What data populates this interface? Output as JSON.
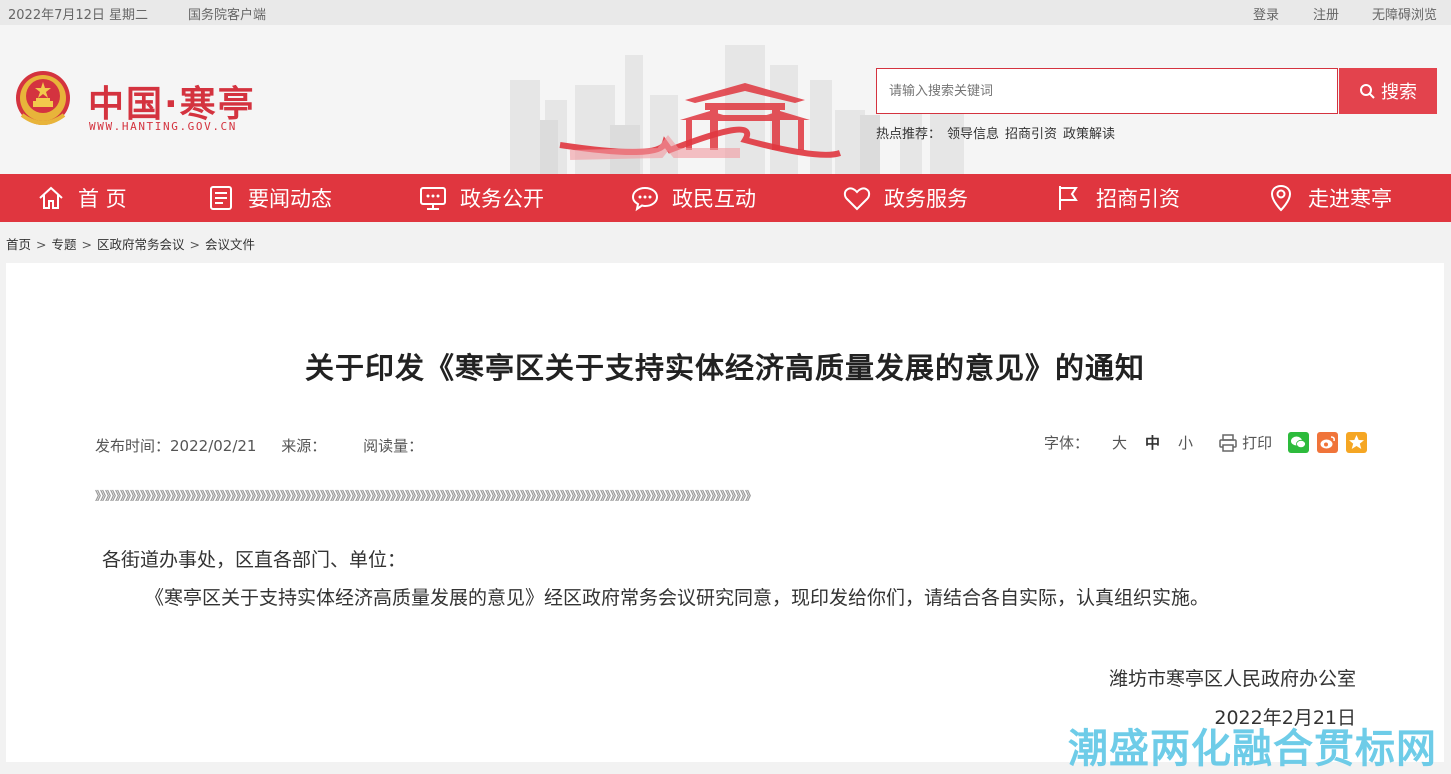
{
  "topbar": {
    "date": "2022年7月12日 星期二",
    "client": "国务院客户端",
    "login": "登录",
    "register": "注册",
    "accessibility": "无障碍浏览"
  },
  "header": {
    "site_name": "中国·寒亭",
    "site_url": "WWW.HANTING.GOV.CN",
    "search_placeholder": "请输入搜索关键词",
    "search_button": "搜索",
    "hot_label": "热点推荐：",
    "hot_items": [
      "领导信息",
      "招商引资",
      "政策解读"
    ]
  },
  "nav": [
    {
      "label": "首 页",
      "icon": "home-icon"
    },
    {
      "label": "要闻动态",
      "icon": "news-icon"
    },
    {
      "label": "政务公开",
      "icon": "monitor-icon"
    },
    {
      "label": "政民互动",
      "icon": "chat-icon"
    },
    {
      "label": "政务服务",
      "icon": "heart-icon"
    },
    {
      "label": "招商引资",
      "icon": "flag-icon"
    },
    {
      "label": "走进寒亭",
      "icon": "location-icon"
    }
  ],
  "breadcrumb": [
    "首页",
    "专题",
    "区政府常务会议",
    "会议文件"
  ],
  "article": {
    "title": "关于印发《寒亭区关于支持实体经济高质量发展的意见》的通知",
    "publish_label": "发布时间：",
    "publish_date": "2022/02/21",
    "source_label": "来源：",
    "read_label": "阅读量：",
    "font_label": "字体：",
    "font_large": "大",
    "font_medium": "中",
    "font_small": "小",
    "print_label": "打印",
    "salutation": "各街道办事处，区直各部门、单位：",
    "body": "《寒亭区关于支持实体经济高质量发展的意见》经区政府常务会议研究同意，现印发给你们，请结合各自实际，认真组织实施。",
    "sign_org": "潍坊市寒亭区人民政府办公室",
    "sign_date": "2022年2月21日"
  },
  "watermark": "潮盛两化融合贯标网",
  "colors": {
    "brand_red": "#e0363f",
    "search_btn": "#e3434d",
    "wechat": "#2dbb3c",
    "weibo": "#f0743a",
    "qzone": "#f5a623"
  }
}
